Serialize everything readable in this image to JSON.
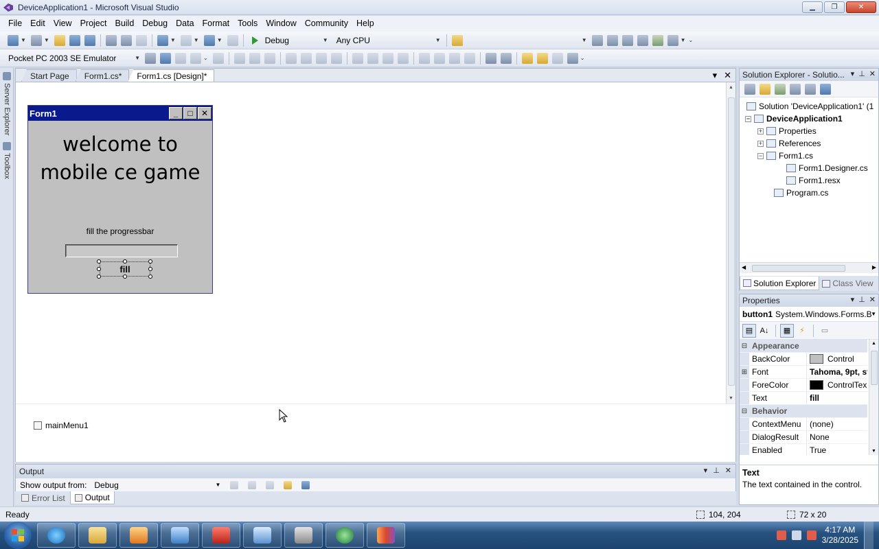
{
  "window": {
    "title": "DeviceApplication1 - Microsoft Visual Studio"
  },
  "menubar": [
    "File",
    "Edit",
    "View",
    "Project",
    "Build",
    "Debug",
    "Data",
    "Format",
    "Tools",
    "Window",
    "Community",
    "Help"
  ],
  "toolbar": {
    "config": "Debug",
    "platform": "Any CPU",
    "device": "Pocket PC 2003 SE Emulator"
  },
  "left_strip": {
    "server_explorer": "Server Explorer",
    "toolbox": "Toolbox"
  },
  "doc_tabs": [
    {
      "label": "Start Page",
      "active": false
    },
    {
      "label": "Form1.cs*",
      "active": false
    },
    {
      "label": "Form1.cs [Design]*",
      "active": true
    }
  ],
  "form": {
    "title": "Form1",
    "welcome_text": "welcome to mobile ce game",
    "instruction": "fill the progressbar",
    "progress": 0,
    "button_text": "fill"
  },
  "component_tray": {
    "item": "mainMenu1"
  },
  "output": {
    "title": "Output",
    "show_from_label": "Show output from:",
    "show_from_value": "Debug"
  },
  "bottom_tabs": [
    "Error List",
    "Output"
  ],
  "solution_explorer": {
    "title": "Solution Explorer - Solutio...",
    "tree": [
      {
        "label": "Solution 'DeviceApplication1' (1",
        "level": 0,
        "bold": false,
        "expander": ""
      },
      {
        "label": "DeviceApplication1",
        "level": 1,
        "bold": true,
        "expander": "-"
      },
      {
        "label": "Properties",
        "level": 2,
        "bold": false,
        "expander": "+"
      },
      {
        "label": "References",
        "level": 2,
        "bold": false,
        "expander": "+"
      },
      {
        "label": "Form1.cs",
        "level": 2,
        "bold": false,
        "expander": "-"
      },
      {
        "label": "Form1.Designer.cs",
        "level": 3,
        "bold": false,
        "expander": ""
      },
      {
        "label": "Form1.resx",
        "level": 3,
        "bold": false,
        "expander": ""
      },
      {
        "label": "Program.cs",
        "level": 2,
        "bold": false,
        "expander": ""
      }
    ],
    "tabs": [
      "Solution Explorer",
      "Class View"
    ]
  },
  "properties": {
    "title": "Properties",
    "object_name": "button1",
    "object_type": "System.Windows.Forms.B",
    "rows": [
      {
        "kind": "category",
        "name": "Appearance"
      },
      {
        "kind": "prop",
        "name": "BackColor",
        "value": "Control",
        "swatch": "#c0c0c0",
        "expander": "",
        "bold": false
      },
      {
        "kind": "prop",
        "name": "Font",
        "value": "Tahoma, 9pt, st",
        "swatch": "",
        "expander": "+",
        "bold": true
      },
      {
        "kind": "prop",
        "name": "ForeColor",
        "value": "ControlTex",
        "swatch": "#000000",
        "expander": "",
        "bold": false
      },
      {
        "kind": "prop",
        "name": "Text",
        "value": "fill",
        "swatch": "",
        "expander": "",
        "bold": true
      },
      {
        "kind": "category",
        "name": "Behavior"
      },
      {
        "kind": "prop",
        "name": "ContextMenu",
        "value": "(none)",
        "swatch": "",
        "expander": "",
        "bold": false
      },
      {
        "kind": "prop",
        "name": "DialogResult",
        "value": "None",
        "swatch": "",
        "expander": "",
        "bold": false
      },
      {
        "kind": "prop",
        "name": "Enabled",
        "value": "True",
        "swatch": "",
        "expander": "",
        "bold": false
      }
    ],
    "description_title": "Text",
    "description_text": "The text contained in the control."
  },
  "statusbar": {
    "text": "Ready",
    "position": "104, 204",
    "size": "72 x 20"
  },
  "taskbar": {
    "time": "4:17 AM",
    "date": "3/28/2025"
  }
}
